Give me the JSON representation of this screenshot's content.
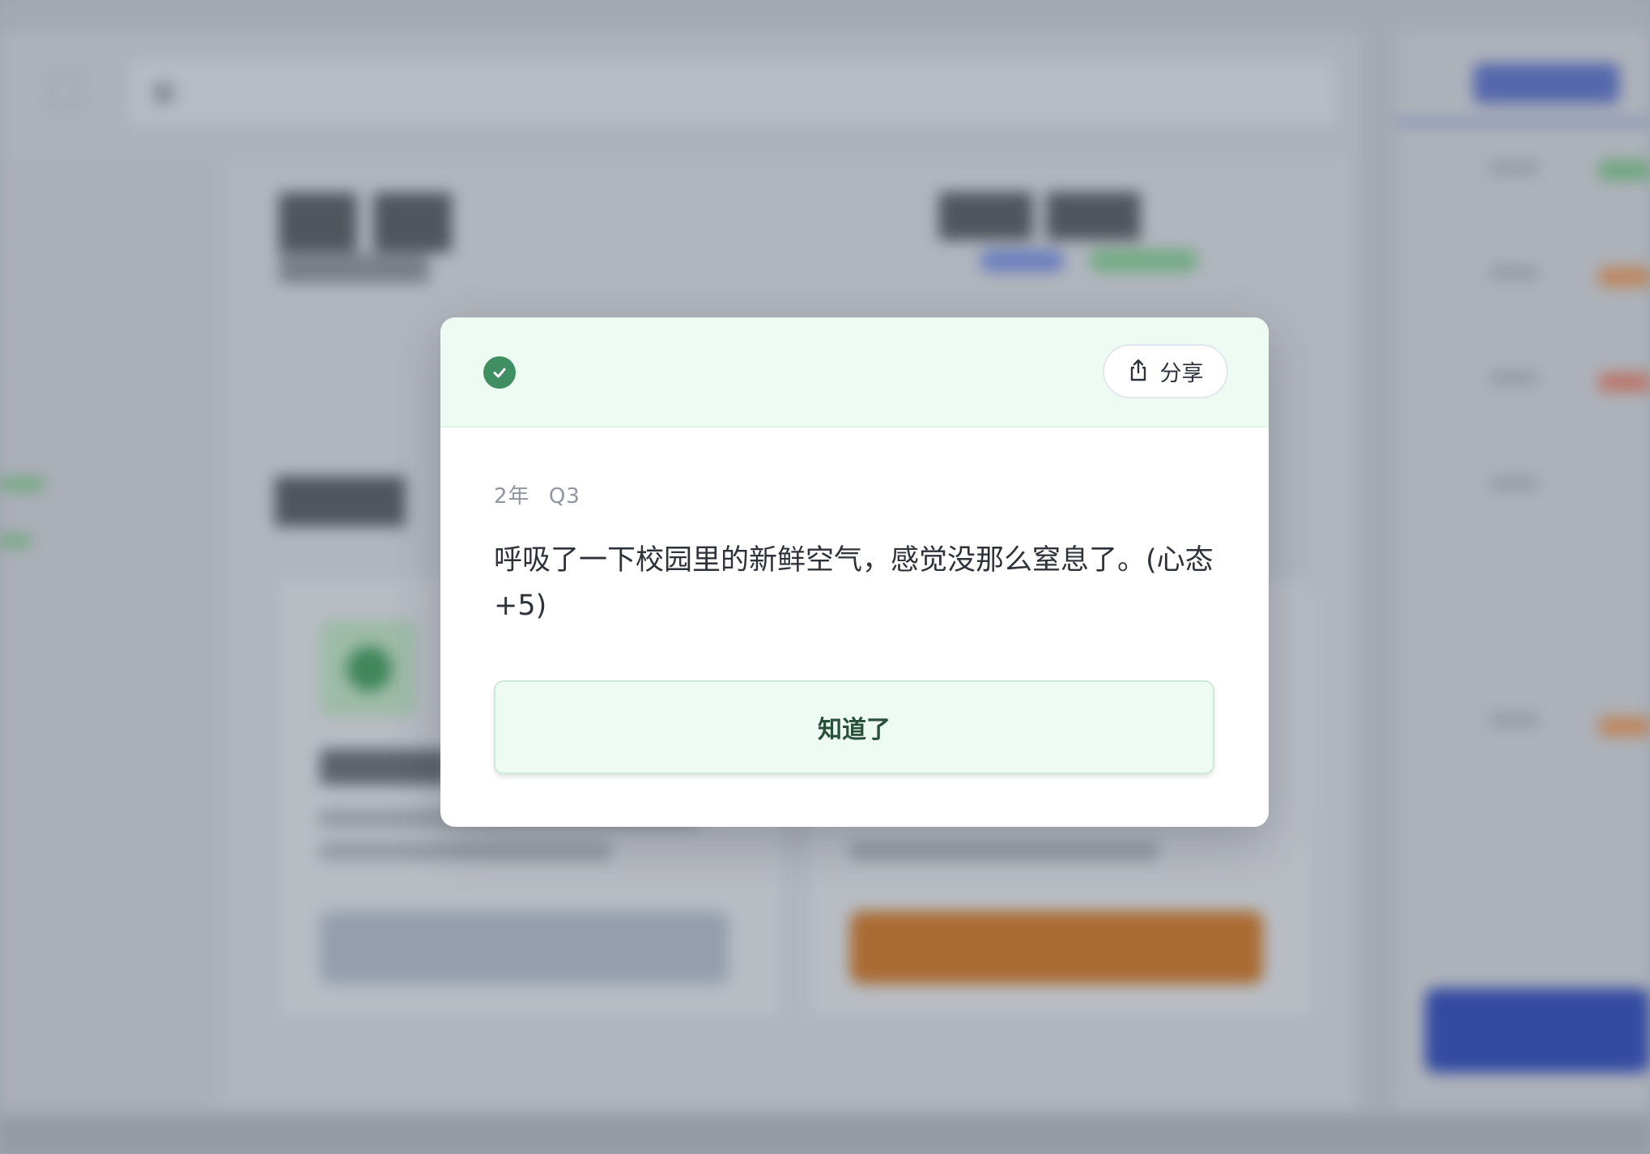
{
  "dialog": {
    "share_label": "分享",
    "meta": {
      "year": "2年",
      "quarter": "Q3"
    },
    "message": "呼吸了一下校园里的新鲜空气，感觉没那么窒息了。(心态+5)",
    "confirm_label": "知道了"
  },
  "icons": {
    "status": "check-circle-icon",
    "share": "share-icon"
  },
  "colors": {
    "success": "#3f8f63",
    "header_bg": "#eefbf3",
    "button_text": "#28503a"
  }
}
